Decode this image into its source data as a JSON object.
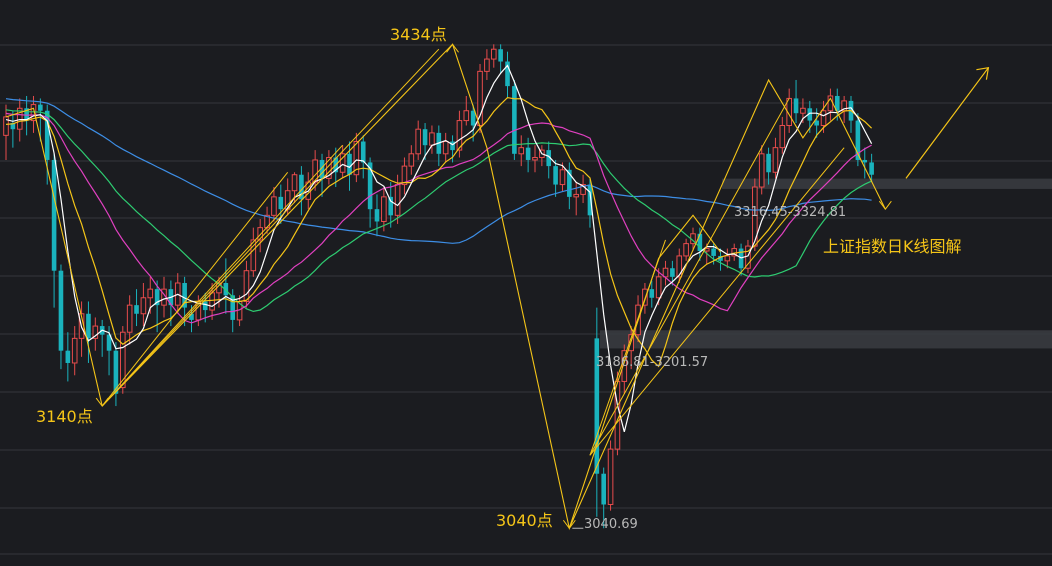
{
  "chart_data": {
    "type": "candlestick",
    "title": "上证指数日K线图解",
    "annotations": {
      "high": "3434点",
      "low_left": "3140点",
      "low_mid": "3040点",
      "low_value": "3040.69",
      "zone_upper": "3316.45-3324.81",
      "zone_lower": "3186.81-3201.57"
    },
    "colors": {
      "background": "#1b1c20",
      "grid": "#34363b",
      "up": "#e74c4c",
      "down": "#1ab3bd",
      "ma5": "#ffffff",
      "ma10": "#f5c518",
      "ma20": "#e040c0",
      "ma30": "#2ecc71",
      "ma60": "#3d8ee6",
      "trend": "#f5c518",
      "annotation": "#f5c518",
      "value_text": "#b8b8b8",
      "zone": "#3a3c42"
    },
    "y_range": [
      3010,
      3470
    ],
    "zones": [
      {
        "from": 3316.45,
        "to": 3324.81
      },
      {
        "from": 3186.81,
        "to": 3201.57
      }
    ],
    "candles": [
      [
        3360,
        3375,
        3340,
        3385
      ],
      [
        3370,
        3365,
        3350,
        3380
      ],
      [
        3365,
        3382,
        3355,
        3390
      ],
      [
        3382,
        3372,
        3360,
        3392
      ],
      [
        3372,
        3385,
        3362,
        3392
      ],
      [
        3385,
        3380,
        3355,
        3390
      ],
      [
        3380,
        3340,
        3320,
        3385
      ],
      [
        3340,
        3250,
        3220,
        3345
      ],
      [
        3250,
        3185,
        3170,
        3255
      ],
      [
        3185,
        3175,
        3160,
        3200
      ],
      [
        3175,
        3195,
        3165,
        3205
      ],
      [
        3195,
        3215,
        3180,
        3225
      ],
      [
        3215,
        3195,
        3175,
        3225
      ],
      [
        3195,
        3205,
        3185,
        3212
      ],
      [
        3205,
        3198,
        3180,
        3210
      ],
      [
        3198,
        3185,
        3165,
        3205
      ],
      [
        3185,
        3150,
        3140,
        3192
      ],
      [
        3155,
        3200,
        3150,
        3205
      ],
      [
        3200,
        3222,
        3190,
        3230
      ],
      [
        3222,
        3215,
        3205,
        3235
      ],
      [
        3215,
        3228,
        3205,
        3240
      ],
      [
        3228,
        3235,
        3215,
        3245
      ],
      [
        3235,
        3222,
        3200,
        3242
      ],
      [
        3222,
        3235,
        3212,
        3245
      ],
      [
        3235,
        3222,
        3205,
        3242
      ],
      [
        3222,
        3240,
        3215,
        3248
      ],
      [
        3240,
        3220,
        3205,
        3245
      ],
      [
        3215,
        3210,
        3200,
        3222
      ],
      [
        3210,
        3225,
        3205,
        3230
      ],
      [
        3225,
        3218,
        3208,
        3232
      ],
      [
        3218,
        3232,
        3210,
        3240
      ],
      [
        3232,
        3240,
        3220,
        3245
      ],
      [
        3240,
        3230,
        3215,
        3260
      ],
      [
        3230,
        3210,
        3200,
        3235
      ],
      [
        3210,
        3225,
        3205,
        3230
      ],
      [
        3225,
        3250,
        3220,
        3258
      ],
      [
        3250,
        3275,
        3245,
        3285
      ],
      [
        3275,
        3285,
        3265,
        3292
      ],
      [
        3285,
        3295,
        3280,
        3302
      ],
      [
        3295,
        3310,
        3290,
        3318
      ],
      [
        3310,
        3300,
        3288,
        3320
      ],
      [
        3300,
        3315,
        3295,
        3325
      ],
      [
        3315,
        3328,
        3305,
        3330
      ],
      [
        3328,
        3308,
        3295,
        3335
      ],
      [
        3308,
        3322,
        3300,
        3330
      ],
      [
        3322,
        3340,
        3315,
        3348
      ],
      [
        3340,
        3325,
        3310,
        3345
      ],
      [
        3325,
        3342,
        3320,
        3348
      ],
      [
        3342,
        3330,
        3318,
        3350
      ],
      [
        3330,
        3345,
        3325,
        3352
      ],
      [
        3345,
        3328,
        3315,
        3355
      ],
      [
        3328,
        3355,
        3322,
        3362
      ],
      [
        3355,
        3338,
        3325,
        3360
      ],
      [
        3338,
        3300,
        3285,
        3342
      ],
      [
        3300,
        3290,
        3278,
        3312
      ],
      [
        3290,
        3310,
        3282,
        3318
      ],
      [
        3310,
        3295,
        3285,
        3322
      ],
      [
        3295,
        3320,
        3288,
        3328
      ],
      [
        3320,
        3335,
        3312,
        3342
      ],
      [
        3335,
        3345,
        3328,
        3352
      ],
      [
        3345,
        3365,
        3340,
        3372
      ],
      [
        3365,
        3352,
        3340,
        3370
      ],
      [
        3352,
        3362,
        3345,
        3368
      ],
      [
        3362,
        3345,
        3335,
        3368
      ],
      [
        3345,
        3355,
        3338,
        3362
      ],
      [
        3355,
        3348,
        3338,
        3360
      ],
      [
        3348,
        3372,
        3342,
        3380
      ],
      [
        3372,
        3380,
        3368,
        3392
      ],
      [
        3380,
        3368,
        3355,
        3385
      ],
      [
        3368,
        3412,
        3362,
        3418
      ],
      [
        3412,
        3422,
        3405,
        3430
      ],
      [
        3422,
        3430,
        3415,
        3434
      ],
      [
        3430,
        3420,
        3410,
        3434
      ],
      [
        3420,
        3400,
        3390,
        3428
      ],
      [
        3400,
        3345,
        3340,
        3405
      ],
      [
        3345,
        3350,
        3335,
        3360
      ],
      [
        3350,
        3340,
        3330,
        3358
      ],
      [
        3340,
        3342,
        3330,
        3352
      ],
      [
        3342,
        3348,
        3335,
        3352
      ],
      [
        3348,
        3335,
        3325,
        3355
      ],
      [
        3335,
        3320,
        3310,
        3340
      ],
      [
        3320,
        3332,
        3314,
        3338
      ],
      [
        3332,
        3310,
        3300,
        3338
      ],
      [
        3310,
        3312,
        3295,
        3322
      ],
      [
        3312,
        3320,
        3305,
        3328
      ],
      [
        3320,
        3295,
        3285,
        3325
      ],
      [
        3195,
        3085,
        3050,
        3220
      ],
      [
        3085,
        3060,
        3040.69,
        3090
      ],
      [
        3060,
        3105,
        3055,
        3112
      ],
      [
        3105,
        3160,
        3100,
        3168
      ],
      [
        3160,
        3185,
        3150,
        3190
      ],
      [
        3185,
        3198,
        3170,
        3205
      ],
      [
        3198,
        3222,
        3192,
        3230
      ],
      [
        3222,
        3235,
        3215,
        3240
      ],
      [
        3235,
        3228,
        3220,
        3242
      ],
      [
        3228,
        3245,
        3222,
        3252
      ],
      [
        3245,
        3252,
        3238,
        3258
      ],
      [
        3252,
        3245,
        3238,
        3258
      ],
      [
        3245,
        3262,
        3240,
        3268
      ],
      [
        3262,
        3272,
        3258,
        3276
      ],
      [
        3272,
        3280,
        3266,
        3285
      ],
      [
        3280,
        3266,
        3258,
        3285
      ],
      [
        3266,
        3268,
        3255,
        3272
      ],
      [
        3268,
        3262,
        3255,
        3272
      ],
      [
        3262,
        3258,
        3250,
        3268
      ],
      [
        3258,
        3262,
        3252,
        3268
      ],
      [
        3262,
        3268,
        3258,
        3272
      ],
      [
        3268,
        3252,
        3246,
        3272
      ],
      [
        3252,
        3270,
        3248,
        3275
      ],
      [
        3270,
        3318,
        3266,
        3325
      ],
      [
        3318,
        3345,
        3312,
        3352
      ],
      [
        3345,
        3330,
        3320,
        3350
      ],
      [
        3330,
        3350,
        3325,
        3358
      ],
      [
        3350,
        3368,
        3345,
        3375
      ],
      [
        3368,
        3390,
        3362,
        3398
      ],
      [
        3390,
        3378,
        3370,
        3405
      ],
      [
        3378,
        3382,
        3370,
        3390
      ],
      [
        3382,
        3372,
        3362,
        3388
      ],
      [
        3372,
        3368,
        3358,
        3382
      ],
      [
        3368,
        3380,
        3362,
        3388
      ],
      [
        3380,
        3392,
        3372,
        3398
      ],
      [
        3392,
        3380,
        3372,
        3398
      ],
      [
        3380,
        3388,
        3370,
        3392
      ],
      [
        3388,
        3372,
        3362,
        3392
      ],
      [
        3372,
        3340,
        3335,
        3378
      ],
      [
        3340,
        3338,
        3325,
        3350
      ],
      [
        3338,
        3328,
        3322,
        3345
      ]
    ]
  }
}
